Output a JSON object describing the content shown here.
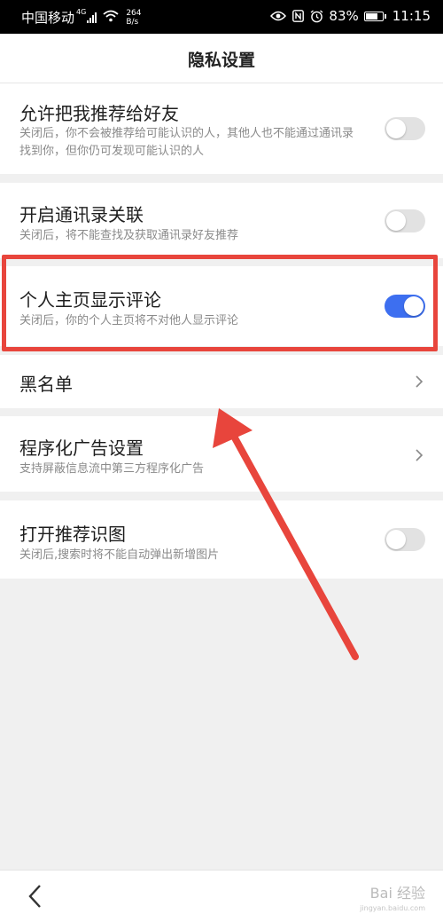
{
  "status_bar": {
    "carrier": "中国移动",
    "network_type": "4G",
    "speed_value": "264",
    "speed_unit": "B/s",
    "battery_percent": "83%",
    "battery_level": 0.83,
    "time": "11:15"
  },
  "header": {
    "title": "隐私设置"
  },
  "settings": [
    {
      "title": "允许把我推荐给好友",
      "description": "关闭后，你不会被推荐给可能认识的人，其他人也不能通过通讯录找到你，但你仍可发现可能认识的人",
      "control": "toggle",
      "enabled": false
    },
    {
      "title": "开启通讯录关联",
      "description": "关闭后，将不能查找及获取通讯录好友推荐",
      "control": "toggle",
      "enabled": false
    },
    {
      "title": "个人主页显示评论",
      "description": "关闭后，你的个人主页将不对他人显示评论",
      "control": "toggle",
      "enabled": true
    },
    {
      "title": "黑名单",
      "control": "chevron"
    },
    {
      "title": "程序化广告设置",
      "description": "支持屏蔽信息流中第三方程序化广告",
      "control": "chevron"
    },
    {
      "title": "打开推荐识图",
      "description": "关闭后,搜索时将不能自动弹出新增图片",
      "control": "toggle",
      "enabled": false
    }
  ],
  "watermark": {
    "text": "Bai 经验",
    "sub": "jingyan.baidu.com"
  },
  "colors": {
    "accent": "#3d6ff0",
    "highlight": "#e8453c"
  }
}
